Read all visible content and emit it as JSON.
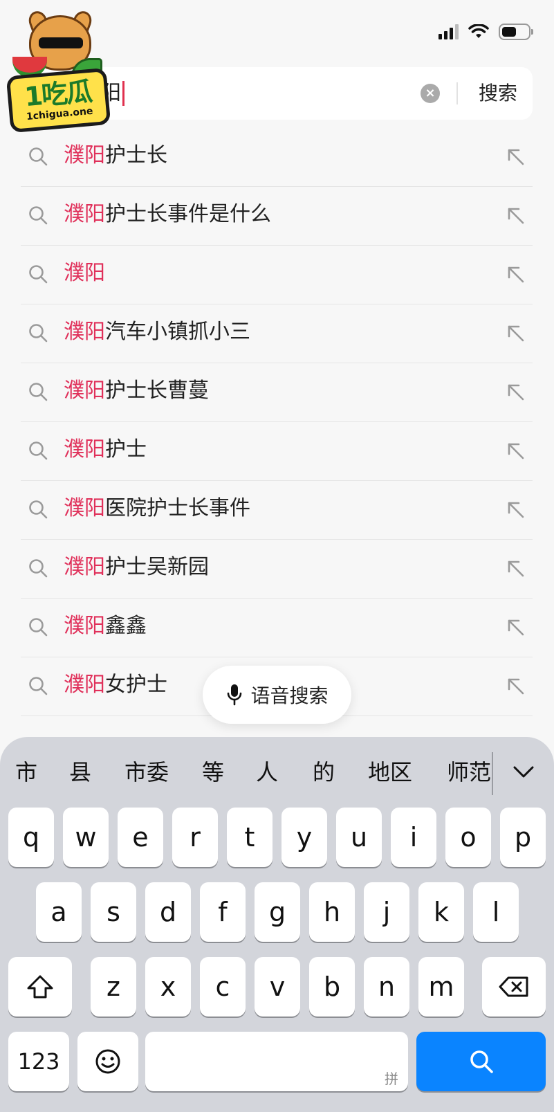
{
  "watermark": {
    "title": "1吃瓜",
    "subtitle": "1chigua.one"
  },
  "search": {
    "query": "濮阳",
    "visible_query": "阳",
    "search_button": "搜索",
    "clear_icon": "clear-circle-icon"
  },
  "suggestions": [
    {
      "highlight": "濮阳",
      "rest": "护士长"
    },
    {
      "highlight": "濮阳",
      "rest": "护士长事件是什么"
    },
    {
      "highlight": "濮阳",
      "rest": ""
    },
    {
      "highlight": "濮阳",
      "rest": "汽车小镇抓小三"
    },
    {
      "highlight": "濮阳",
      "rest": "护士长曹蔓"
    },
    {
      "highlight": "濮阳",
      "rest": "护士"
    },
    {
      "highlight": "濮阳",
      "rest": "医院护士长事件"
    },
    {
      "highlight": "濮阳",
      "rest": "护士吴新园"
    },
    {
      "highlight": "濮阳",
      "rest": "鑫鑫"
    },
    {
      "highlight": "濮阳",
      "rest": "女护士"
    }
  ],
  "voice_search": {
    "label": "语音搜索",
    "icon": "microphone-icon"
  },
  "keyboard": {
    "candidates": [
      "市",
      "县",
      "市委",
      "等",
      "人",
      "的",
      "地区",
      "师范"
    ],
    "row1": [
      "q",
      "w",
      "e",
      "r",
      "t",
      "y",
      "u",
      "i",
      "o",
      "p"
    ],
    "row2": [
      "a",
      "s",
      "d",
      "f",
      "g",
      "h",
      "j",
      "k",
      "l"
    ],
    "row3": [
      "z",
      "x",
      "c",
      "v",
      "b",
      "n",
      "m"
    ],
    "numbers_key": "123",
    "space_hint": "拼",
    "accent_color": "#0a84ff"
  },
  "colors": {
    "highlight": "#e0305a",
    "caret": "#e0304e"
  }
}
